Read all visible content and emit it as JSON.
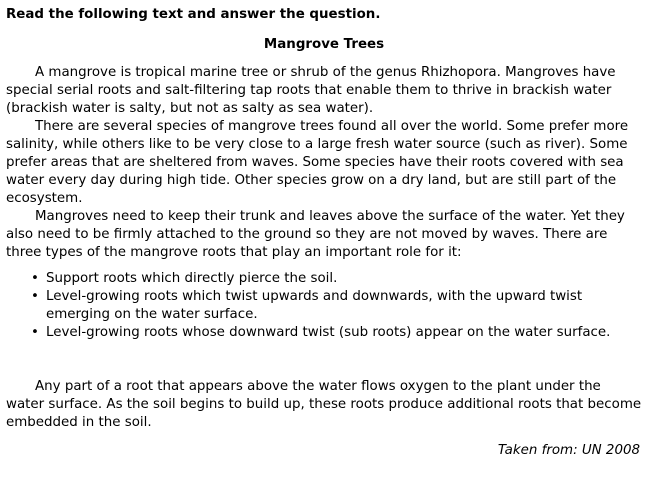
{
  "instruction": "Read the following text and answer the question.",
  "title": "Mangrove Trees",
  "paragraphs": [
    "A mangrove is tropical marine tree or shrub of the genus Rhizhopora. Mangroves have special serial roots and salt-filtering tap roots that enable them to thrive in brackish water (brackish water is salty, but not as salty as sea water).",
    "There are several species of mangrove trees found all over the world. Some prefer more salinity, while others like to be very close to a large fresh water source (such as river). Some prefer areas that are sheltered from waves. Some species have their roots covered with sea water every day during high tide. Other species grow on a dry land, but are still part of the ecosystem.",
    "Mangroves need to keep their trunk and leaves above the surface of the water. Yet they also need to be firmly attached to the ground so they are not moved by waves. There are three types of the mangrove roots that play an important role for it:"
  ],
  "bullets": [
    "Support roots which directly pierce the soil.",
    "Level-growing roots which twist upwards and downwards, with the upward twist emerging on the water surface.",
    "Level-growing roots whose downward twist (sub roots) appear on the water surface."
  ],
  "bullet_symbol": "•",
  "closing_paragraph": "Any part of a root that appears above the water flows oxygen to the plant under the water surface. As the soil begins to build up, these roots produce additional roots that become embedded in the soil.",
  "source": "Taken from: UN 2008"
}
